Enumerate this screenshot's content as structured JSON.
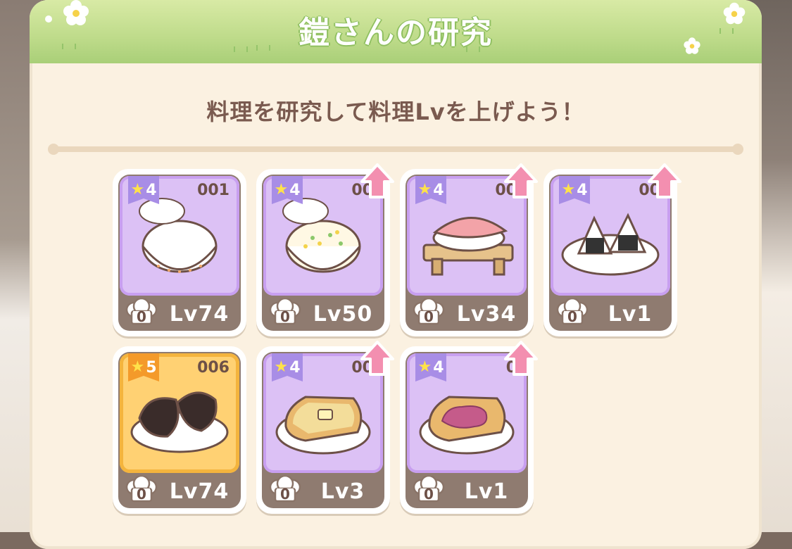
{
  "header": {
    "title": "鎧さんの研究"
  },
  "subtitle": "料理を研究して料理Lvを上げよう！",
  "colors": {
    "header_green": "#bedb8a",
    "card_purple": "#dcc1f5",
    "card_gold": "#ffd173",
    "badge_purple": "#a88de6",
    "badge_orange": "#f49a2a",
    "up_arrow_pink": "#f38fb0"
  },
  "recipes": [
    {
      "stars": "4",
      "number": "001",
      "chef_count": "0",
      "level": "Lv74",
      "rank": "purple",
      "has_upgrade": false,
      "food_icon": "rice-bowl-icon"
    },
    {
      "stars": "4",
      "number": "00",
      "chef_count": "0",
      "level": "Lv50",
      "rank": "purple",
      "has_upgrade": true,
      "food_icon": "fried-rice-bowl-icon"
    },
    {
      "stars": "4",
      "number": "00",
      "chef_count": "0",
      "level": "Lv34",
      "rank": "purple",
      "has_upgrade": true,
      "food_icon": "sushi-on-board-icon"
    },
    {
      "stars": "4",
      "number": "00",
      "chef_count": "0",
      "level": "Lv1",
      "rank": "purple",
      "has_upgrade": true,
      "food_icon": "onigiri-plate-icon"
    },
    {
      "stars": "5",
      "number": "006",
      "chef_count": "0",
      "level": "Lv74",
      "rank": "gold",
      "has_upgrade": false,
      "food_icon": "grilled-onigiri-plate-icon"
    },
    {
      "stars": "4",
      "number": "00",
      "chef_count": "0",
      "level": "Lv3",
      "rank": "purple",
      "has_upgrade": true,
      "food_icon": "butter-toast-icon"
    },
    {
      "stars": "4",
      "number": "0",
      "chef_count": "0",
      "level": "Lv1",
      "rank": "purple",
      "has_upgrade": true,
      "food_icon": "jam-toast-icon"
    }
  ]
}
